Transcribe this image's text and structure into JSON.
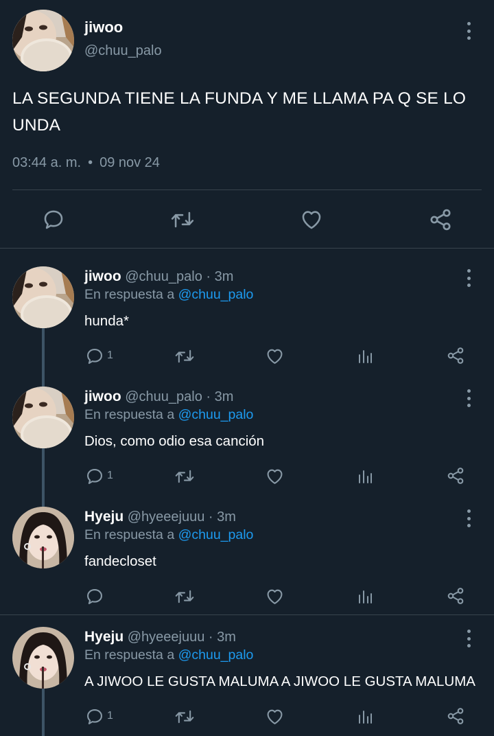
{
  "main": {
    "name": "jiwoo",
    "handle": "@chuu_palo",
    "text": "LA SEGUNDA TIENE LA FUNDA Y ME LLAMA PA Q SE LO UNDA",
    "time": "03:44 a. m.",
    "separator": "•",
    "date": "09 nov 24"
  },
  "reply_prefix": "En respuesta a",
  "replies": [
    {
      "name": "jiwoo",
      "handle": "@chuu_palo",
      "time": "· 3m",
      "mention": "@chuu_palo",
      "text": "hunda*",
      "reply_count": "1",
      "avatar": "jiwoo"
    },
    {
      "name": "jiwoo",
      "handle": "@chuu_palo",
      "time": "· 3m",
      "mention": "@chuu_palo",
      "text": "Dios, como odio esa canción",
      "reply_count": "1",
      "avatar": "jiwoo"
    },
    {
      "name": "Hyeju",
      "handle": "@hyeeejuuu",
      "time": "· 3m",
      "mention": "@chuu_palo",
      "text": "fandecloset",
      "reply_count": "",
      "avatar": "hyeju"
    },
    {
      "name": "Hyeju",
      "handle": "@hyeeejuuu",
      "time": "· 3m",
      "mention": "@chuu_palo",
      "text": "A JIWOO LE GUSTA MALUMA A JIWOO LE GUSTA MALUMA",
      "reply_count": "1",
      "avatar": "hyeju"
    }
  ],
  "icons": {
    "reply": "speech-bubble-icon",
    "retweet": "retweet-icon",
    "like": "heart-icon",
    "views": "bar-chart-icon",
    "share": "share-icon",
    "more": "vertical-dots-icon"
  },
  "colors": {
    "background": "#15202b",
    "text": "#ffffff",
    "secondary": "#8899a6",
    "link": "#1d9bf0",
    "divider": "#38444d"
  }
}
